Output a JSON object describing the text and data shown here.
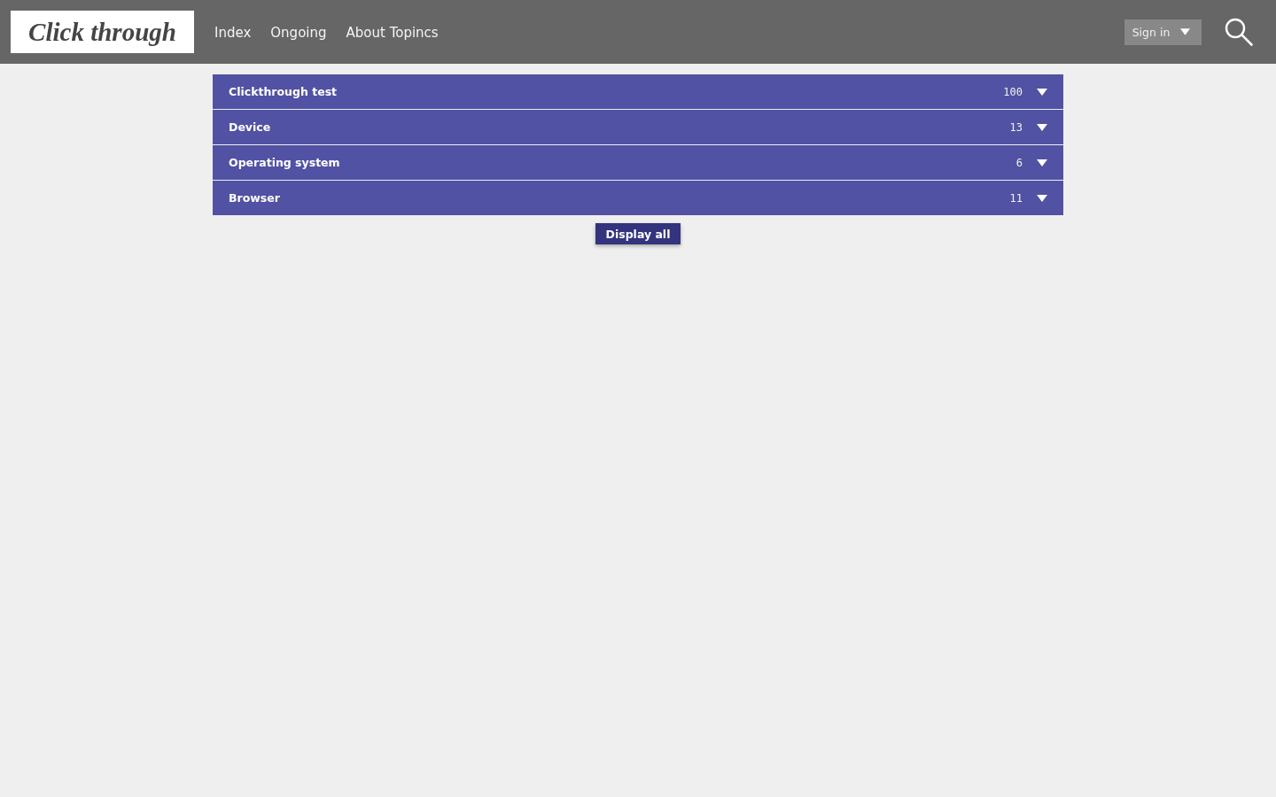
{
  "header": {
    "logo": "Click through",
    "nav": [
      {
        "label": "Index"
      },
      {
        "label": "Ongoing"
      },
      {
        "label": "About Topincs"
      }
    ],
    "sign_in": {
      "label": "Sign in"
    }
  },
  "facets": [
    {
      "title": "Clickthrough test",
      "count": "100"
    },
    {
      "title": "Device",
      "count": "13"
    },
    {
      "title": "Operating system",
      "count": "6"
    },
    {
      "title": "Browser",
      "count": "11"
    }
  ],
  "display_all": {
    "label": "Display all"
  }
}
